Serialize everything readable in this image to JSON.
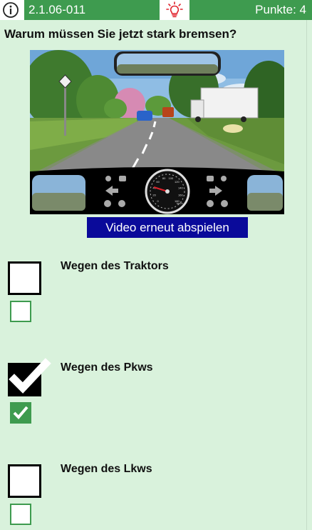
{
  "header": {
    "info_icon": "info-circle-icon",
    "question_id": "2.1.06-011",
    "hint_icon": "lightbulb-icon",
    "points": "Punkte: 4"
  },
  "question": {
    "text": "Warum müssen Sie jetzt stark bremsen?"
  },
  "video": {
    "replay_label": "Video erneut abspielen",
    "speedometer_unit": "km/h",
    "speedometer_ticks": [
      "0",
      "20",
      "40",
      "60",
      "80",
      "100",
      "120",
      "140",
      "160",
      "180"
    ]
  },
  "answers": [
    {
      "label": "Wegen des Traktors",
      "user_checked": false,
      "solution_checked": false
    },
    {
      "label": "Wegen des Pkws",
      "user_checked": true,
      "solution_checked": true
    },
    {
      "label": "Wegen des Lkws",
      "user_checked": false,
      "solution_checked": false
    }
  ],
  "colors": {
    "background": "#d9f2dc",
    "header_green": "#3e9b4f",
    "replay_button": "#0a0a9a",
    "hint_red": "#e0212b"
  }
}
